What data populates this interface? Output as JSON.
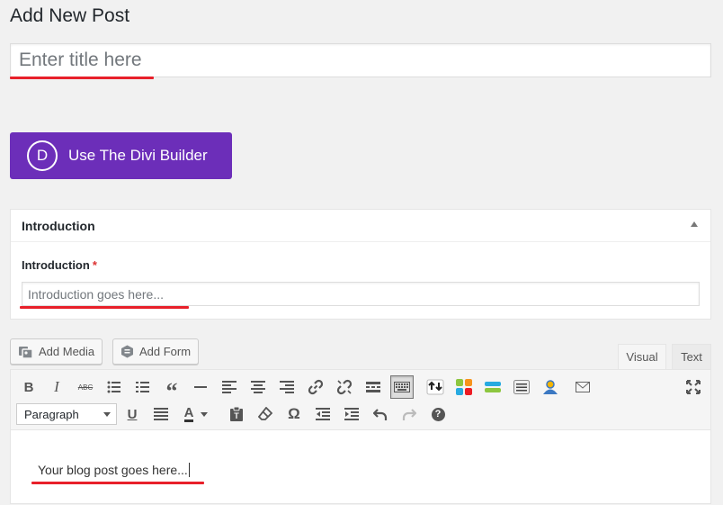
{
  "page": {
    "title": "Add New Post"
  },
  "post_title": {
    "placeholder": "Enter title here",
    "value": ""
  },
  "divi": {
    "logo_letter": "D",
    "label": "Use The Divi Builder",
    "color": "#6c2eb9"
  },
  "intro_box": {
    "title": "Introduction",
    "field_label": "Introduction",
    "required_marker": "*",
    "placeholder": "Introduction goes here..."
  },
  "media_buttons": {
    "add_media": "Add Media",
    "add_form": "Add Form"
  },
  "editor_tabs": {
    "visual": "Visual",
    "text": "Text",
    "active": "Visual"
  },
  "toolbar": {
    "row1": [
      "bold-icon",
      "italic-icon",
      "strikethrough-icon",
      "bullet-list-icon",
      "numbered-list-icon",
      "blockquote-icon",
      "horizontal-line-icon",
      "align-left-icon",
      "align-center-icon",
      "align-right-icon",
      "link-icon",
      "unlink-icon",
      "read-more-icon",
      "toolbar-toggle-icon",
      "shortcode-icon",
      "color-blocks-icon",
      "layers-icon",
      "table-icon",
      "user-icon",
      "email-icon",
      "fullscreen-icon"
    ],
    "row2": [
      "underline-icon",
      "justify-icon",
      "text-color-icon",
      "paste-text-icon",
      "clear-formatting-icon",
      "special-character-icon",
      "outdent-icon",
      "indent-icon",
      "undo-icon",
      "redo-icon",
      "help-icon"
    ],
    "bold_glyph": "B",
    "italic_glyph": "I",
    "strike_glyph": "ABC",
    "underline_glyph": "U",
    "text_color_glyph": "A",
    "omega_glyph": "Ω",
    "help_glyph": "?",
    "quote_glyph": "“",
    "format_select": "Paragraph"
  },
  "editor_content": {
    "text": "Your blog post goes here..."
  },
  "colors": {
    "highlight_underline": "#e8202a",
    "accent": "#6c2eb9"
  }
}
